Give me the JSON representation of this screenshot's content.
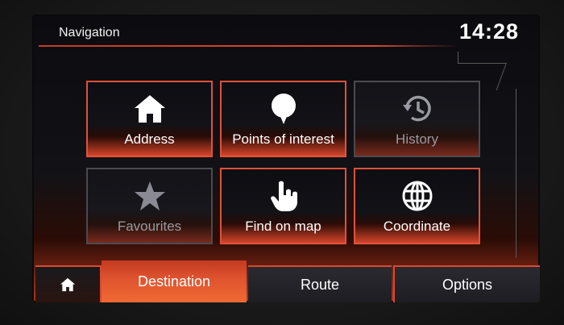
{
  "header": {
    "title": "Navigation",
    "clock": "14:28"
  },
  "tiles": [
    {
      "label": "Address",
      "icon": "home-icon",
      "enabled": true
    },
    {
      "label": "Points of interest",
      "icon": "map-pin-icon",
      "enabled": true
    },
    {
      "label": "History",
      "icon": "history-clock-icon",
      "enabled": false
    },
    {
      "label": "Favourites",
      "icon": "star-icon",
      "enabled": false
    },
    {
      "label": "Find on map",
      "icon": "hand-pointer-icon",
      "enabled": true
    },
    {
      "label": "Coordinate",
      "icon": "globe-icon",
      "enabled": true
    }
  ],
  "tabs": {
    "home_icon": "home-icon",
    "destination": "Destination",
    "route": "Route",
    "options": "Options",
    "active": "Destination"
  },
  "colors": {
    "accent": "#e0513a",
    "active_tab": "#e65a30",
    "text": "#ffffff",
    "disabled_text": "#9a9aa2"
  }
}
